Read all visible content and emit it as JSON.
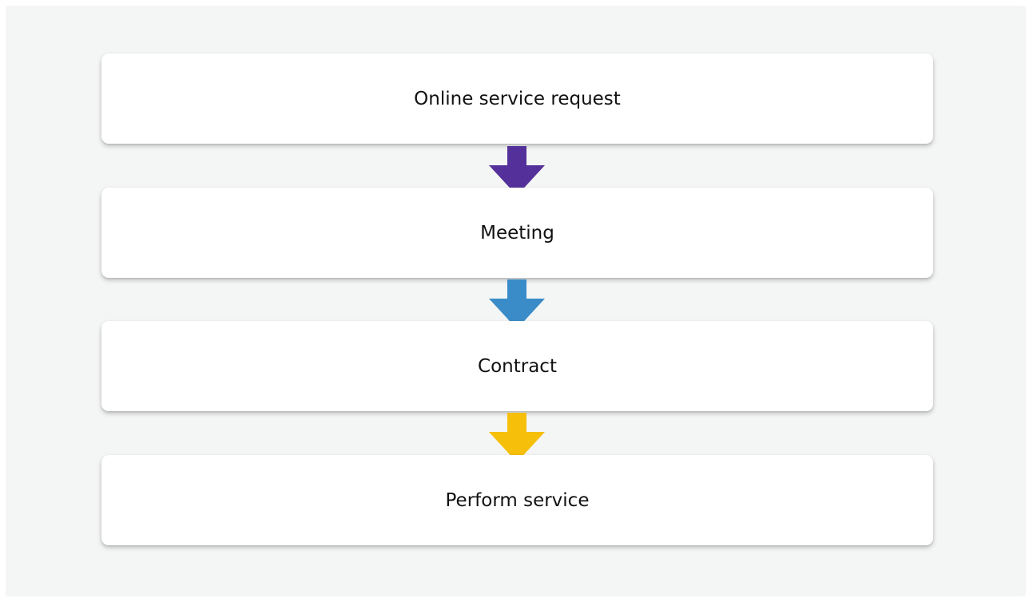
{
  "steps": [
    {
      "label": "Online service request"
    },
    {
      "label": "Meeting"
    },
    {
      "label": "Contract"
    },
    {
      "label": "Perform service"
    }
  ],
  "arrows": [
    {
      "name": "arrow-down-icon",
      "color": "#54319a"
    },
    {
      "name": "arrow-down-icon",
      "color": "#3a8cc8"
    },
    {
      "name": "arrow-down-icon",
      "color": "#f6bf0a"
    }
  ]
}
